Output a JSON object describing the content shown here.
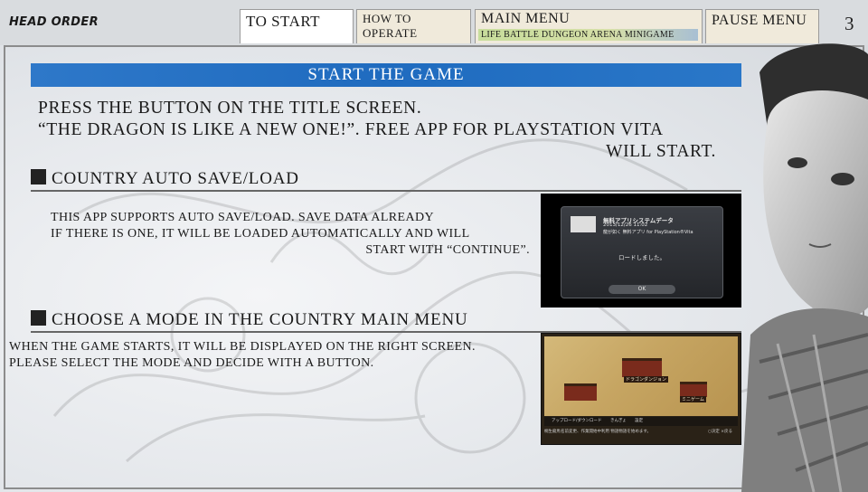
{
  "header": {
    "manual_title": "HEAD ORDER",
    "page_number": "3",
    "tabs": [
      {
        "label": "TO START",
        "active": true
      },
      {
        "label": "HOW TO OPERATE",
        "active": false
      },
      {
        "label": "MAIN MENU",
        "active": false,
        "submenu": "LIFE BATTLE DUNGEON ARENA MINIGAME"
      },
      {
        "label": "PAUSE MENU",
        "active": false
      }
    ]
  },
  "main": {
    "section_title": "START THE GAME",
    "intro_lines": [
      "PRESS THE BUTTON ON THE TITLE SCREEN.",
      "“THE DRAGON IS LIKE A NEW ONE!”. FREE APP FOR PLAYSTATION VITA",
      "WILL START."
    ],
    "sections": [
      {
        "heading": "COUNTRY AUTO SAVE/LOAD",
        "lines": [
          "THIS APP SUPPORTS AUTO SAVE/LOAD. SAVE DATA ALREADY",
          "IF THERE IS ONE, IT WILL BE LOADED AUTOMATICALLY AND WILL",
          "START  WITH “CONTINUE”."
        ]
      },
      {
        "heading": "CHOOSE A MODE IN THE COUNTRY MAIN MENU",
        "lines": [
          "WHEN THE GAME STARTS, IT WILL BE DISPLAYED ON THE RIGHT SCREEN.",
          "PLEASE SELECT THE MODE AND DECIDE WITH A BUTTON."
        ]
      }
    ]
  },
  "screenshot_load": {
    "title": "無料アプリシステムデータ",
    "date": "2013/12/26  11:02",
    "subtitle": "龍が如く 無料アプリ for PlayStation®Vita",
    "message": "ロードしました。",
    "ok_label": "OK"
  },
  "screenshot_menu": {
    "labels": [
      "ドラゴンダンジョン",
      "ミニゲーム"
    ],
    "bar_items": [
      "アップロード/ダウンロード",
      "きんぎょ",
      "設定"
    ],
    "footer": "桐生龍馬名前変更、作業開始中利用\n物語物語を始めます。",
    "footer_right": "○決定 ×戻る"
  },
  "colors": {
    "banner": "#1f6bbf",
    "tab_inactive": "#f0eadb",
    "tab_active": "#ffffff"
  }
}
